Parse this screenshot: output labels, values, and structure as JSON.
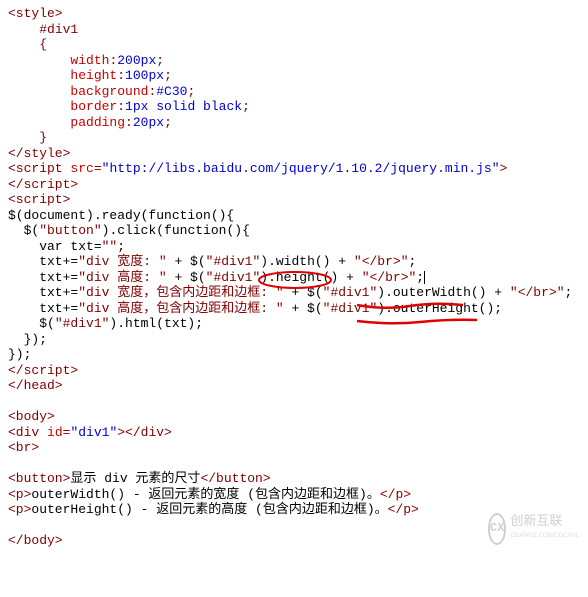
{
  "lines": {
    "l1": "<style>",
    "l2_indent": "    ",
    "l2": "#div1",
    "l3_indent": "    ",
    "l3": "{",
    "l4_indent": "        ",
    "l4p": "width",
    "l4v": "200px",
    "l5_indent": "        ",
    "l5p": "height",
    "l5v": "100px",
    "l6_indent": "        ",
    "l6p": "background",
    "l6v": "#C30",
    "l7_indent": "        ",
    "l7p": "border",
    "l7v": "1px solid black",
    "l8_indent": "        ",
    "l8p": "padding",
    "l8v": "20px",
    "l9_indent": "    ",
    "l9": "}",
    "l10": "</style>",
    "l11_open": "<script ",
    "l11_attr": "src",
    "l11_val": "\"http://libs.baidu.com/jquery/1.10.2/jquery.min.js\"",
    "l11_close": ">",
    "l12": "</script>",
    "l13": "<script>",
    "l14": "$(document).ready(function(){",
    "l15": "  $(",
    "l15_str": "\"button\"",
    "l15_end": ").click(function(){",
    "l16": "    var txt=",
    "l16_str": "\"\"",
    "l16_end": ";",
    "l17a": "    txt+=",
    "l17b": "\"div 宽度: \"",
    "l17c": " + $(",
    "l17d": "\"#div1\"",
    "l17e": ").width() + ",
    "l17f": "\"</br>\"",
    "l17g": ";",
    "l18a": "    txt+=",
    "l18b": "\"div 高度: \"",
    "l18c": " + $(",
    "l18d": "\"#div1\"",
    "l18e": ").height() + ",
    "l18f": "\"</br>\"",
    "l18g": ";",
    "l19a": "    txt+=",
    "l19b": "\"div 宽度，包含内边距和边框: \"",
    "l19c": " + $(",
    "l19d": "\"#div1\"",
    "l19e": ").outerWidth() + ",
    "l19f": "\"</br>\"",
    "l19g": ";",
    "l20a": "    txt+=",
    "l20b": "\"div 高度，包含内边距和边框: \"",
    "l20c": " + $(",
    "l20d": "\"#div1\"",
    "l20e": ").outerHeight();",
    "l21a": "    $(",
    "l21b": "\"#div1\"",
    "l21c": ").html(txt);",
    "l22": "  });",
    "l23": "});",
    "l24": "</script>",
    "l25": "</head>",
    "l26": "<body>",
    "l27a": "<div ",
    "l27attr": "id",
    "l27val": "\"div1\"",
    "l27b": "></div>",
    "l28": "<br>",
    "l29a": "<button>",
    "l29b": "显示 div 元素的尺寸",
    "l29c": "</button>",
    "l30a": "<p>",
    "l30b": "outerWidth() - 返回元素的宽度 (包含内边距和边框)。",
    "l30c": "</p>",
    "l31a": "<p>",
    "l31b": "outerHeight() - 返回元素的高度 (包含内边距和边框)。",
    "l31c": "</p>",
    "l32": "</body>"
  },
  "logo": {
    "mark": "CX",
    "text": "创新互联",
    "sub": "CDXWGZ.COM/CDCXHL"
  },
  "annotations": {
    "a1": "red ellipse around .height()",
    "a2": "red underline under .outerWidth()",
    "a3": "red underline under .outerHeight();"
  }
}
